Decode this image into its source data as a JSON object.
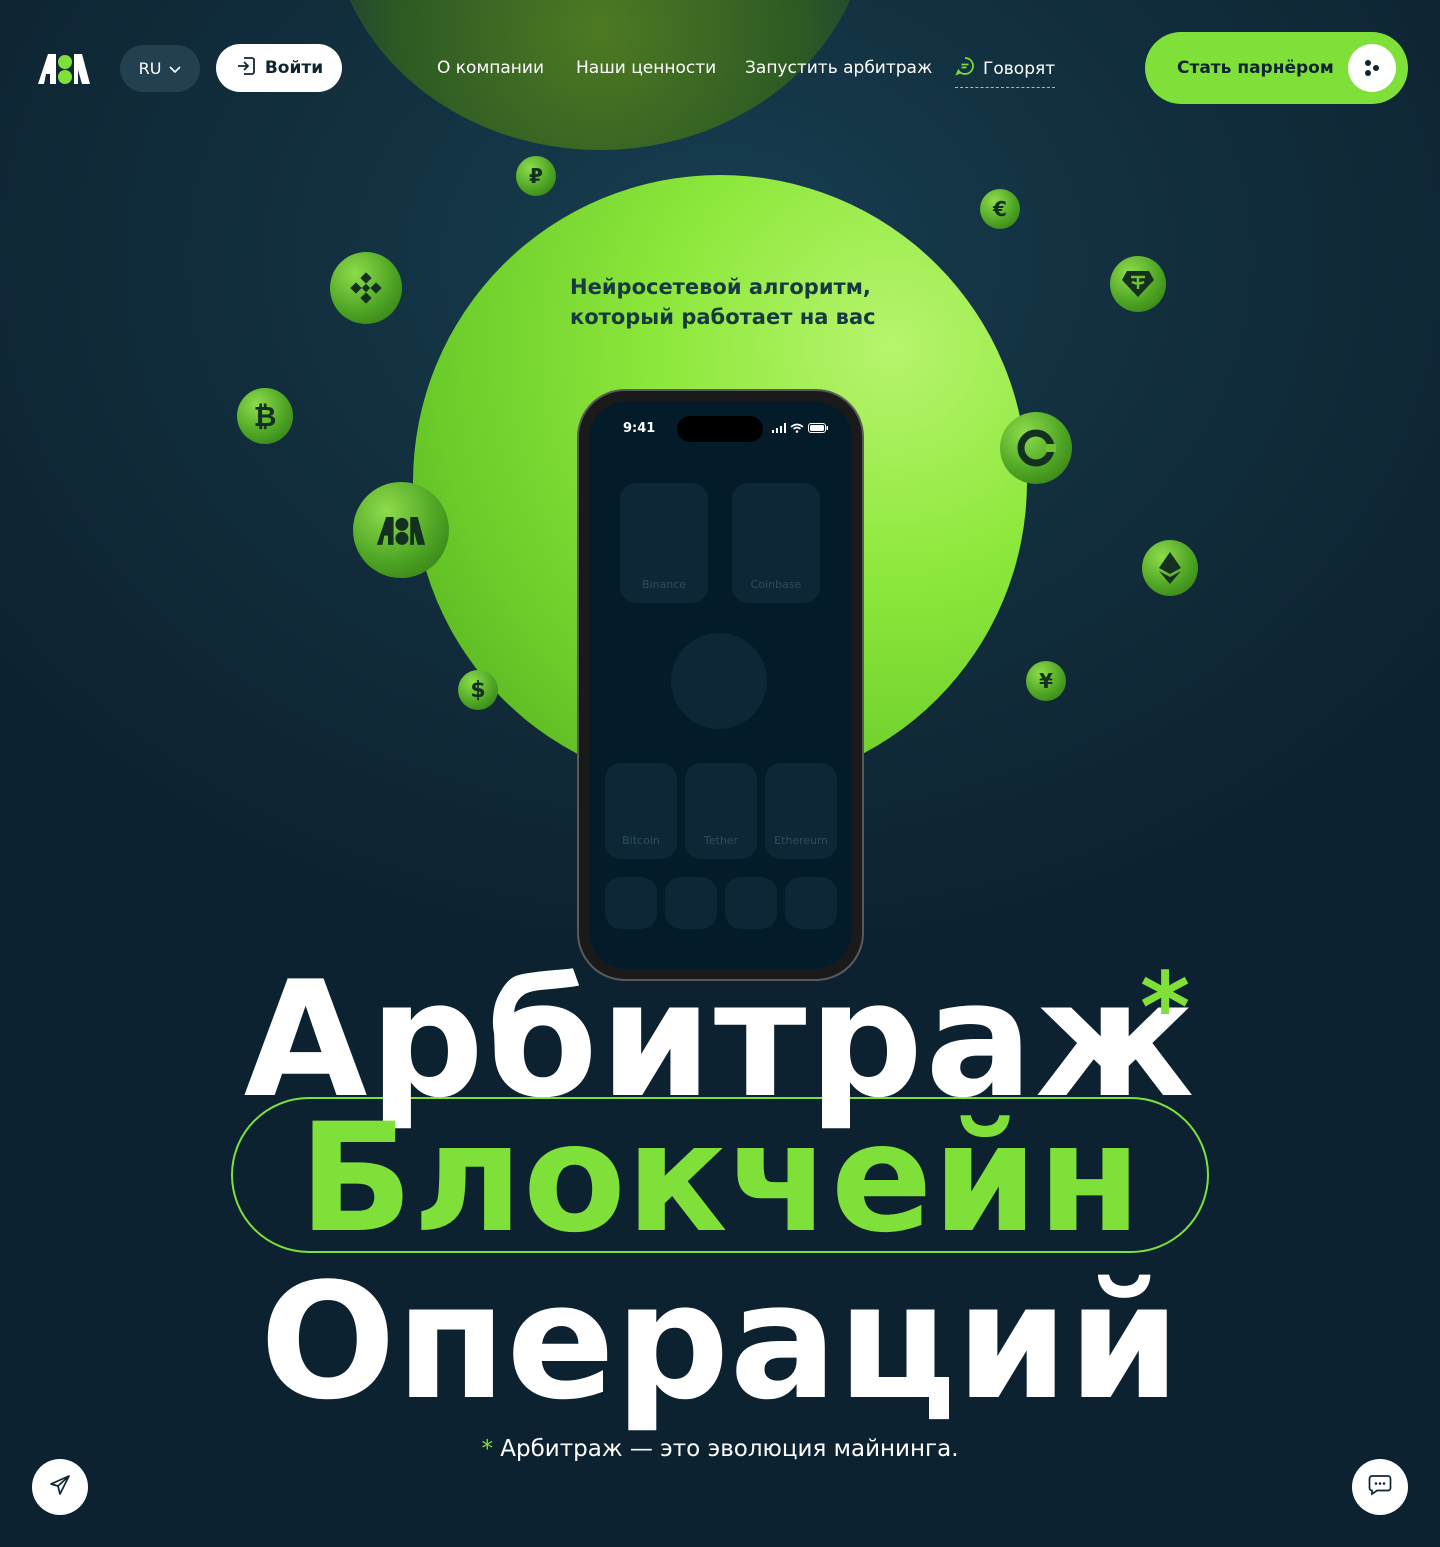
{
  "header": {
    "lang": "RU",
    "login_label": "Войти",
    "nav": [
      {
        "label": "О компании"
      },
      {
        "label": "Наши ценности"
      },
      {
        "label": "Запустить арбитраж"
      },
      {
        "label": "Говорят"
      }
    ],
    "cta_label": "Стать парнёром"
  },
  "hero": {
    "tagline_line1": "Нейросетевой алгоритм,",
    "tagline_line2": "который работает на вас",
    "phone": {
      "time": "9:41",
      "tiles_top": [
        "Binance",
        "Coinbase"
      ],
      "tiles_middle": [
        "Bitcoin",
        "Tether",
        "Ethereum"
      ]
    },
    "coins": [
      "₽",
      "€",
      "₿",
      "$",
      "¥"
    ],
    "headline": {
      "line1": "Арбитраж",
      "asterisk": "*",
      "line2": "Блокчейн",
      "line3": "Операций"
    },
    "footnote_star": "*",
    "footnote_text": " Арбитраж — это эволюция майнинга."
  },
  "colors": {
    "accent": "#7fe03a",
    "background": "#12303f",
    "white": "#ffffff"
  },
  "icons": [
    "logo-icon",
    "chevron-down-icon",
    "login-icon",
    "chat-icon",
    "dots-icon",
    "telegram-icon",
    "message-icon",
    "binance-icon",
    "tether-icon",
    "coinbase-icon",
    "ethereum-icon"
  ]
}
